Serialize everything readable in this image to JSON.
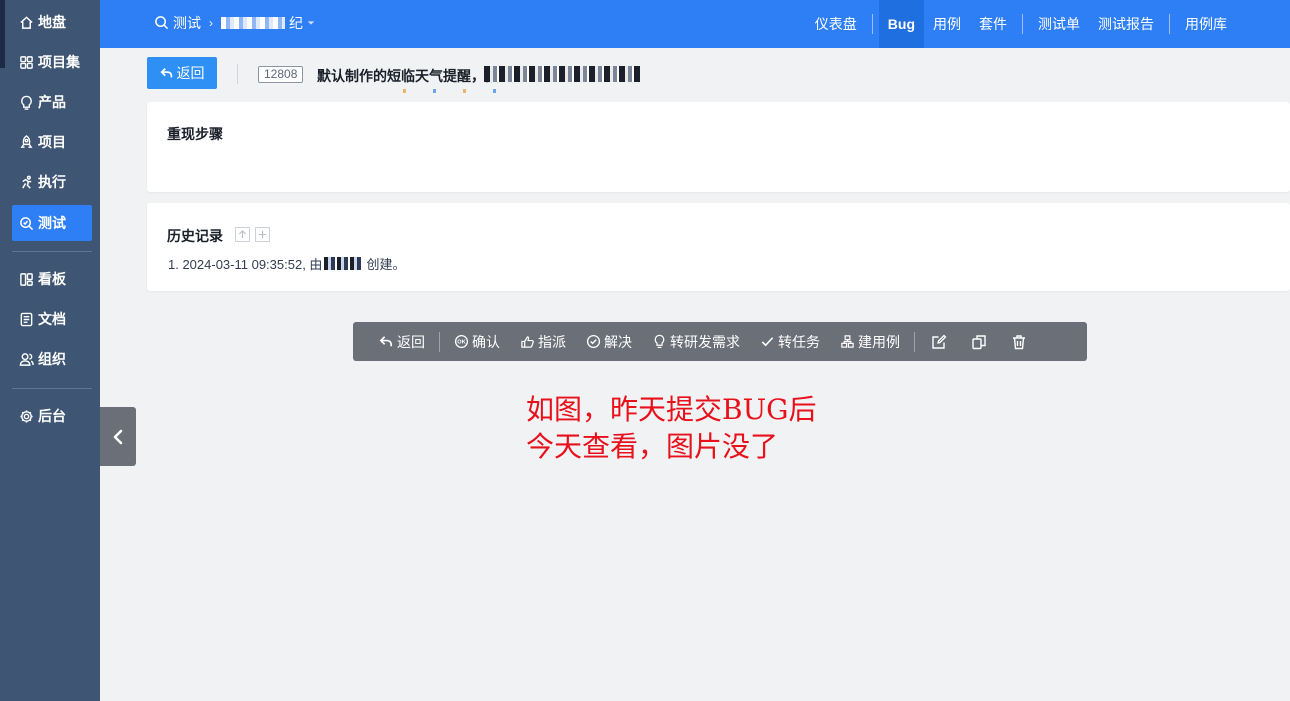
{
  "sidebar": {
    "items": [
      {
        "label": "地盘",
        "icon": "home-icon"
      },
      {
        "label": "项目集",
        "icon": "grid-icon"
      },
      {
        "label": "产品",
        "icon": "bulb-icon"
      },
      {
        "label": "项目",
        "icon": "rocket-icon"
      },
      {
        "label": "执行",
        "icon": "run-icon"
      },
      {
        "label": "测试",
        "icon": "test-search-icon",
        "active": true
      },
      {
        "label": "看板",
        "icon": "kanban-icon"
      },
      {
        "label": "文档",
        "icon": "doc-icon"
      },
      {
        "label": "组织",
        "icon": "users-icon"
      },
      {
        "label": "后台",
        "icon": "gear-icon"
      }
    ]
  },
  "header": {
    "breadcrumb_root": "测试",
    "breadcrumb_tail": "纪",
    "nav": [
      {
        "label": "仪表盘"
      },
      {
        "label": "Bug",
        "active": true
      },
      {
        "label": "用例"
      },
      {
        "label": "套件"
      },
      {
        "label": "测试单"
      },
      {
        "label": "测试报告"
      },
      {
        "label": "用例库"
      }
    ]
  },
  "bug": {
    "back_label": "返回",
    "id": "12808",
    "title": "默认制作的短临天气提醒，预"
  },
  "steps_card": {
    "title": "重现步骤"
  },
  "history_card": {
    "title": "历史记录",
    "entry_prefix": "1. 2024-03-11 09:35:52, 由",
    "entry_suffix": "创建。"
  },
  "toolbar": {
    "back": "返回",
    "confirm": "确认",
    "assign": "指派",
    "resolve": "解决",
    "to_story": "转研发需求",
    "to_task": "转任务",
    "create_case": "建用例"
  },
  "annotation": {
    "line1": "如图，昨天提交BUG后",
    "line2": "今天查看，图片没了"
  },
  "colors": {
    "sidebar": "#3e5674",
    "header": "#2e7ff5",
    "active": "#2e7ff5",
    "toolbar": "#6b6f77",
    "annotation": "#e8101a"
  }
}
